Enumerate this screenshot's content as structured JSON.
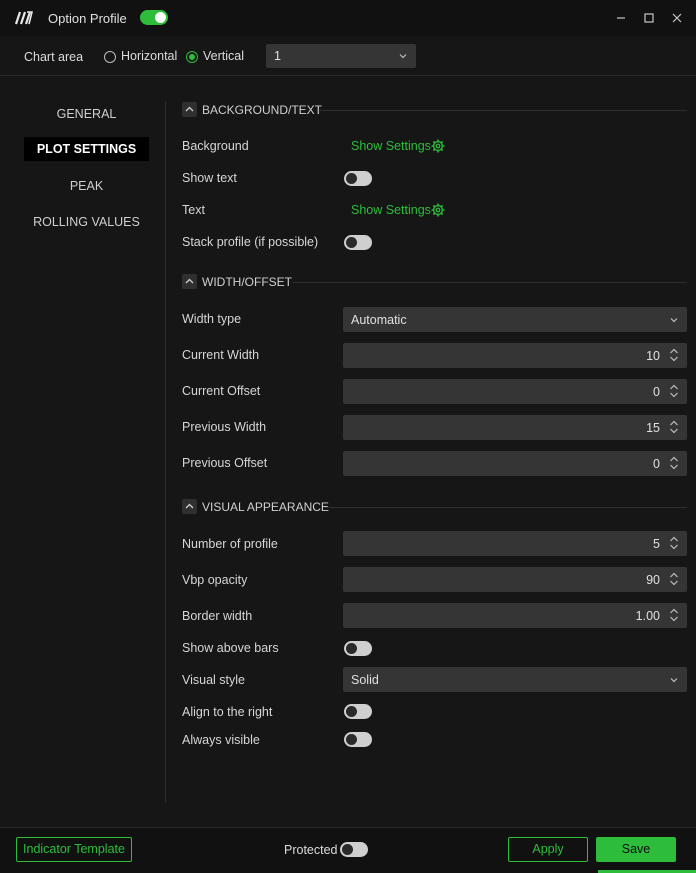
{
  "window": {
    "title": "Option Profile",
    "enabled": true,
    "controls": [
      "minimize-icon",
      "maximize-icon",
      "close-icon"
    ]
  },
  "chart_area": {
    "label": "Chart area",
    "options": [
      {
        "label": "Horizontal",
        "selected": false
      },
      {
        "label": "Vertical",
        "selected": true
      }
    ],
    "select_value": "1"
  },
  "sidebar": {
    "items": [
      {
        "label": "GENERAL",
        "active": false
      },
      {
        "label": "PLOT SETTINGS",
        "active": true
      },
      {
        "label": "PEAK",
        "active": false
      },
      {
        "label": "ROLLING VALUES",
        "active": false
      }
    ]
  },
  "sections": {
    "background_text": {
      "title": "BACKGROUND/TEXT",
      "background_label": "Background",
      "background_link": "Show Settings",
      "show_text_label": "Show text",
      "show_text_on": false,
      "text_label": "Text",
      "text_link": "Show Settings",
      "stack_label": "Stack profile (if possible)",
      "stack_on": false
    },
    "width_offset": {
      "title": "WIDTH/OFFSET",
      "width_type_label": "Width type",
      "width_type_value": "Automatic",
      "current_width_label": "Current Width",
      "current_width_value": "10",
      "current_offset_label": "Current Offset",
      "current_offset_value": "0",
      "previous_width_label": "Previous Width",
      "previous_width_value": "15",
      "previous_offset_label": "Previous Offset",
      "previous_offset_value": "0"
    },
    "visual_appearance": {
      "title": "VISUAL APPEARANCE",
      "number_label": "Number of profile",
      "number_value": "5",
      "opacity_label": "Vbp opacity",
      "opacity_value": "90",
      "border_label": "Border width",
      "border_value": "1.00",
      "above_bars_label": "Show above bars",
      "above_bars_on": false,
      "style_label": "Visual style",
      "style_value": "Solid",
      "align_label": "Align to the right",
      "align_on": false,
      "always_label": "Always visible",
      "always_on": false
    }
  },
  "footer": {
    "template_button": "Indicator Template",
    "protected_label": "Protected",
    "protected_on": false,
    "apply_button": "Apply",
    "save_button": "Save"
  },
  "colors": {
    "accent": "#2dbd3a",
    "background": "#161616",
    "titlebar": "#111111",
    "input": "#353535"
  }
}
